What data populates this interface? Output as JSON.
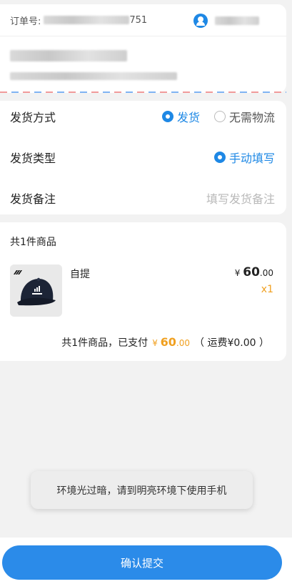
{
  "order": {
    "number_label": "订单号:",
    "number_suffix": "751"
  },
  "delivery": {
    "method_label": "发货方式",
    "method_options": [
      "发货",
      "无需物流"
    ],
    "method_selected": "发货",
    "type_label": "发货类型",
    "type_option": "手动填写",
    "remark_label": "发货备注",
    "remark_placeholder": "填写发货备注"
  },
  "goods": {
    "count_label": "共1件商品",
    "item": {
      "name": "自提",
      "price_symbol": "¥",
      "price_int": "60",
      "price_dec": ".00",
      "quantity": "x1",
      "image_icon": "baseball-cap"
    },
    "summary": {
      "text": "共1件商品，已支付",
      "paid_symbol": "¥",
      "paid_int": "60",
      "paid_dec": ".00",
      "shipping": "（ 运费¥0.00 ）"
    }
  },
  "toast": {
    "message": "环境光过暗，请到明亮环境下使用手机"
  },
  "footer": {
    "submit_label": "确认提交"
  },
  "colors": {
    "accent": "#1e88e5",
    "price_orange": "#f0a020",
    "button": "#2b8be9"
  }
}
